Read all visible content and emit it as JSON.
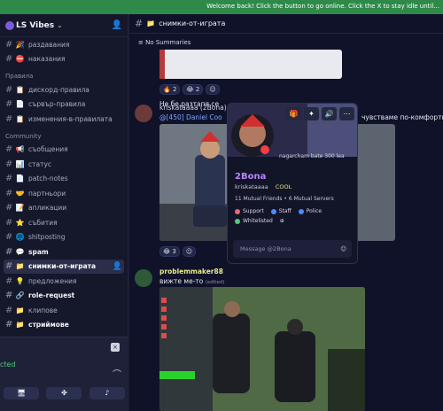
{
  "topbar": {
    "text": "Welcome back! Click the button to go online. Click the X to stay idle until..."
  },
  "server": {
    "name": "LS Vibes"
  },
  "sidebar": {
    "channels_top": [
      {
        "emoji": "🎉",
        "label": "раздавания",
        "unread": false
      },
      {
        "emoji": "⛔",
        "label": "наказания",
        "unread": false
      }
    ],
    "category_rules": "Правила",
    "channels_rules": [
      {
        "emoji": "📋",
        "label": "дискорд-правила",
        "unread": false
      },
      {
        "emoji": "📄",
        "label": "сървър-правила",
        "unread": false
      },
      {
        "emoji": "📋",
        "label": "изменения-в-правилата",
        "unread": false
      }
    ],
    "category_community": "Community",
    "channels_community": [
      {
        "emoji": "📢",
        "label": "съобщения",
        "unread": false
      },
      {
        "emoji": "📊",
        "label": "статус",
        "unread": false
      },
      {
        "emoji": "📄",
        "label": "patch-notes",
        "unread": false
      },
      {
        "emoji": "🤝",
        "label": "партньори",
        "unread": false
      },
      {
        "emoji": "📝",
        "label": "апликации",
        "unread": false
      },
      {
        "emoji": "⭐",
        "label": "събития",
        "unread": false
      },
      {
        "emoji": "🌐",
        "label": "shitposting",
        "unread": false
      },
      {
        "emoji": "💬",
        "label": "spam",
        "unread": true
      },
      {
        "emoji": "📁",
        "label": "снимки-от-играта",
        "unread": true,
        "active": true
      },
      {
        "emoji": "💡",
        "label": "предложения",
        "unread": false
      },
      {
        "emoji": "🔗",
        "label": "role-request",
        "unread": true
      },
      {
        "emoji": "📁",
        "label": "клипове",
        "unread": false
      },
      {
        "emoji": "📁",
        "label": "стриймове",
        "unread": true
      }
    ]
  },
  "voice": {
    "status": "cted"
  },
  "channel": {
    "title": "снимки-от-играта",
    "summaries": "No Summaries"
  },
  "messages": {
    "reactions_top": [
      {
        "emoji": "🔥",
        "count": "2"
      },
      {
        "emoji": "😂",
        "count": "2"
      }
    ],
    "text_1": "Не бе разтапя се",
    "author_2": "kriskataaaa (2Bona)",
    "reply_2": "@[450] Daniel Coo",
    "reply_tail": "чувстваме по-комфортно и н",
    "reactions_2": [
      {
        "emoji": "😂",
        "count": "3"
      }
    ],
    "author_3": "problemmaker88",
    "text_3": "вижте ме-то",
    "edited": "(edited)"
  },
  "popup": {
    "name": "2Bona",
    "username": "kriskataaaa",
    "tag": "COOL",
    "bio": "nagarcham bate 300 lea",
    "mutual": "11 Mutual Friends • 6 Mutual Servers",
    "roles": [
      {
        "name": "Support",
        "color": "#e06c75"
      },
      {
        "name": "Staff",
        "color": "#4a8cff"
      },
      {
        "name": "Police",
        "color": "#4a8cff"
      },
      {
        "name": "Whitelisted",
        "color": "#54c97d"
      }
    ],
    "placeholder": "Message @2Bona"
  }
}
